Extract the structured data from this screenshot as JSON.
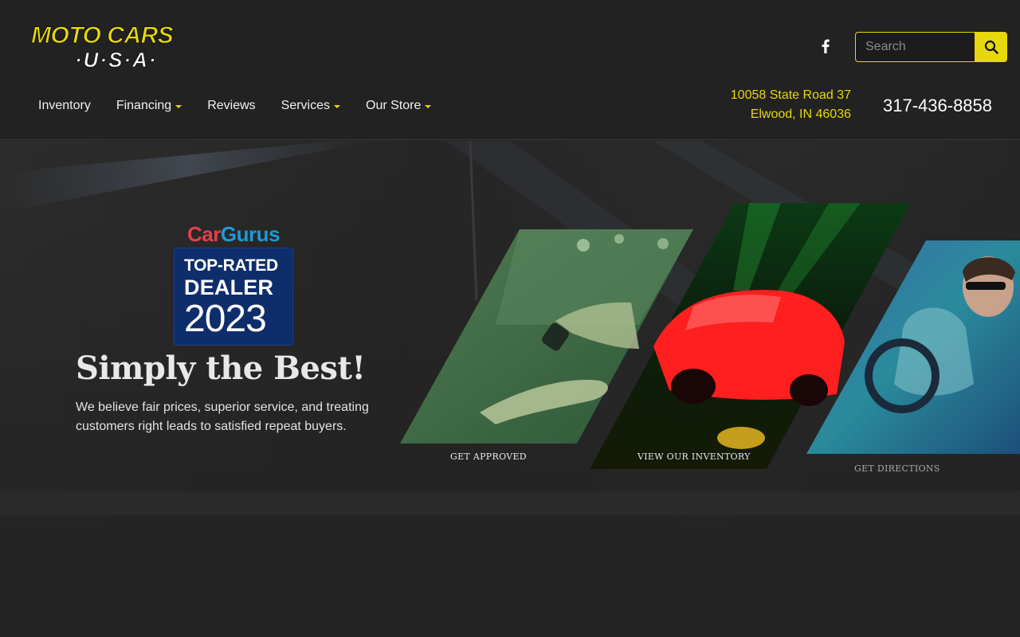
{
  "brand": {
    "logo_line1": "MOTO CARS",
    "logo_line2": "·U·S·A·",
    "accent_color": "#e6d80a"
  },
  "header": {
    "social_icon": "facebook-icon",
    "search": {
      "placeholder": "Search",
      "icon": "search-icon"
    },
    "nav": [
      {
        "label": "Inventory",
        "dropdown": false
      },
      {
        "label": "Financing",
        "dropdown": true
      },
      {
        "label": "Reviews",
        "dropdown": false
      },
      {
        "label": "Services",
        "dropdown": true
      },
      {
        "label": "Our Store",
        "dropdown": true
      }
    ],
    "address_line1": "10058 State Road 37",
    "address_line2": "Elwood, IN 46036",
    "phone": "317-436-8858"
  },
  "hero": {
    "badge": {
      "brand_car": "Car",
      "brand_gurus": "Gurus",
      "line1": "TOP-RATED",
      "line2": "DEALER",
      "year": "2023"
    },
    "title": "Simply the Best!",
    "text": "We believe fair prices, superior service, and treating customers right leads to satisfied repeat buyers.",
    "panels": [
      {
        "label": "GET APPROVED",
        "image": "hand-keys-image"
      },
      {
        "label": "VIEW OUR INVENTORY",
        "image": "red-sports-car-image"
      },
      {
        "label": "GET DIRECTIONS",
        "image": "driver-image"
      }
    ]
  }
}
